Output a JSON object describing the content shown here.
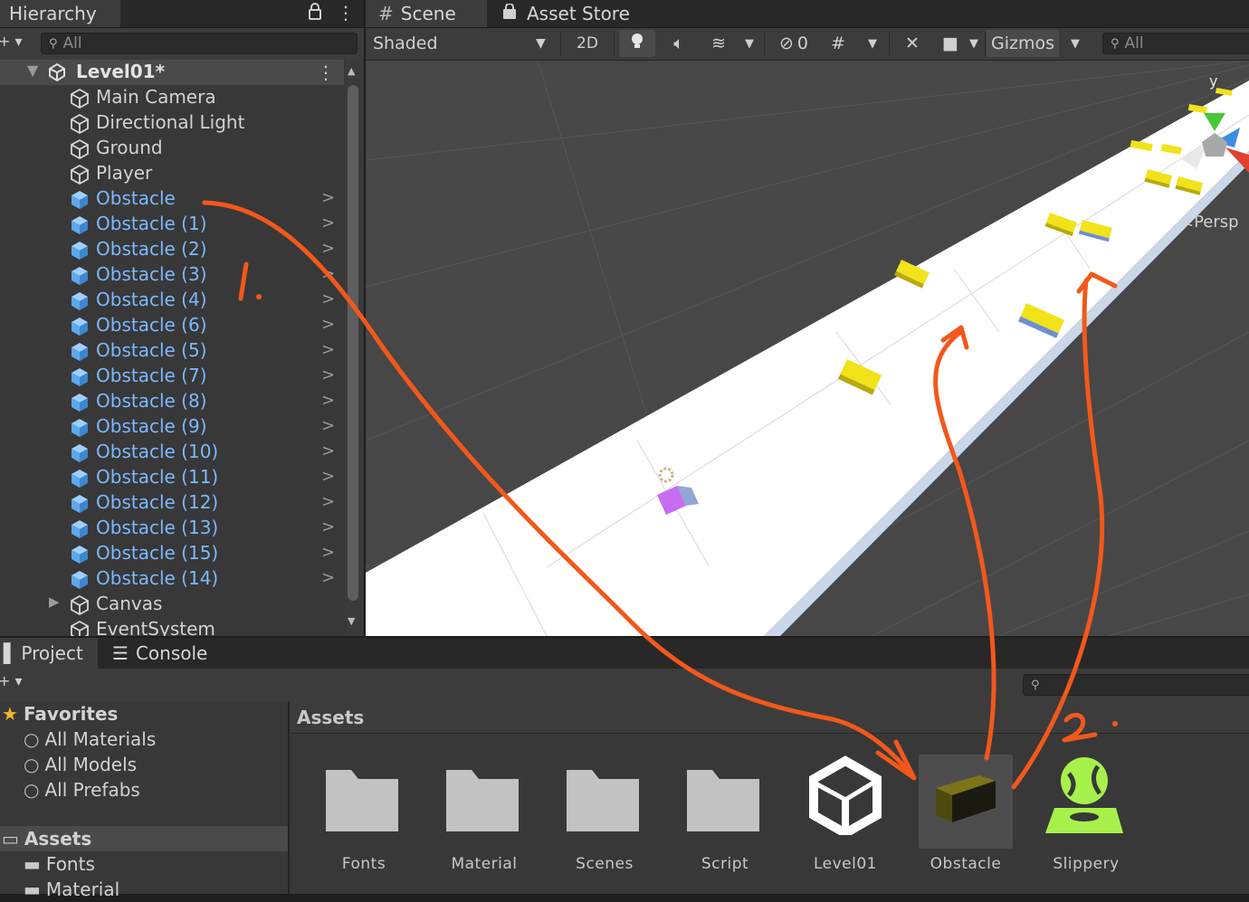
{
  "hierarchy": {
    "tab_label": "Hierarchy",
    "search_placeholder": "All",
    "scene_name": "Level01*",
    "items": [
      {
        "label": "Main Camera",
        "prefab": false
      },
      {
        "label": "Directional Light",
        "prefab": false
      },
      {
        "label": "Ground",
        "prefab": false
      },
      {
        "label": "Player",
        "prefab": false
      },
      {
        "label": "Obstacle",
        "prefab": true
      },
      {
        "label": "Obstacle (1)",
        "prefab": true
      },
      {
        "label": "Obstacle (2)",
        "prefab": true
      },
      {
        "label": "Obstacle (3)",
        "prefab": true
      },
      {
        "label": "Obstacle (4)",
        "prefab": true
      },
      {
        "label": "Obstacle (6)",
        "prefab": true
      },
      {
        "label": "Obstacle (5)",
        "prefab": true
      },
      {
        "label": "Obstacle (7)",
        "prefab": true
      },
      {
        "label": "Obstacle (8)",
        "prefab": true
      },
      {
        "label": "Obstacle (9)",
        "prefab": true
      },
      {
        "label": "Obstacle (10)",
        "prefab": true
      },
      {
        "label": "Obstacle (11)",
        "prefab": true
      },
      {
        "label": "Obstacle (12)",
        "prefab": true
      },
      {
        "label": "Obstacle (13)",
        "prefab": true
      },
      {
        "label": "Obstacle (15)",
        "prefab": true
      },
      {
        "label": "Obstacle (14)",
        "prefab": true
      },
      {
        "label": "Canvas",
        "prefab": false
      },
      {
        "label": "EventSystem",
        "prefab": false
      }
    ]
  },
  "scene": {
    "tabs": [
      "Scene",
      "Asset Store"
    ],
    "shading_mode": "Shaded",
    "toggle_2d": "2D",
    "hidden_count": "0",
    "gizmos_label": "Gizmos",
    "search_placeholder": "All",
    "gizmo_axis_label": "y",
    "projection_label": "Persp"
  },
  "project": {
    "tabs": [
      "Project",
      "Console"
    ],
    "favorites_label": "Favorites",
    "favorites": [
      "All Materials",
      "All Models",
      "All Prefabs"
    ],
    "assets_root": "Assets",
    "asset_folders_tree": [
      "Fonts",
      "Material"
    ],
    "breadcrumb": "Assets",
    "assets": [
      {
        "name": "Fonts",
        "kind": "folder"
      },
      {
        "name": "Material",
        "kind": "folder"
      },
      {
        "name": "Scenes",
        "kind": "folder"
      },
      {
        "name": "Script",
        "kind": "folder"
      },
      {
        "name": "Level01",
        "kind": "unity-scene"
      },
      {
        "name": "Obstacle",
        "kind": "prefab"
      },
      {
        "name": "Slippery",
        "kind": "physic-material"
      }
    ]
  },
  "annotations": {
    "step1": "1.",
    "step2": "2.",
    "arrow_color": "#f2581b"
  },
  "colors": {
    "prefab_blue": "#7cb8ff",
    "obstacle_yellow": "#f2e21a",
    "player_purple": "#c86cf0",
    "slippery_green": "#a6f24a"
  }
}
